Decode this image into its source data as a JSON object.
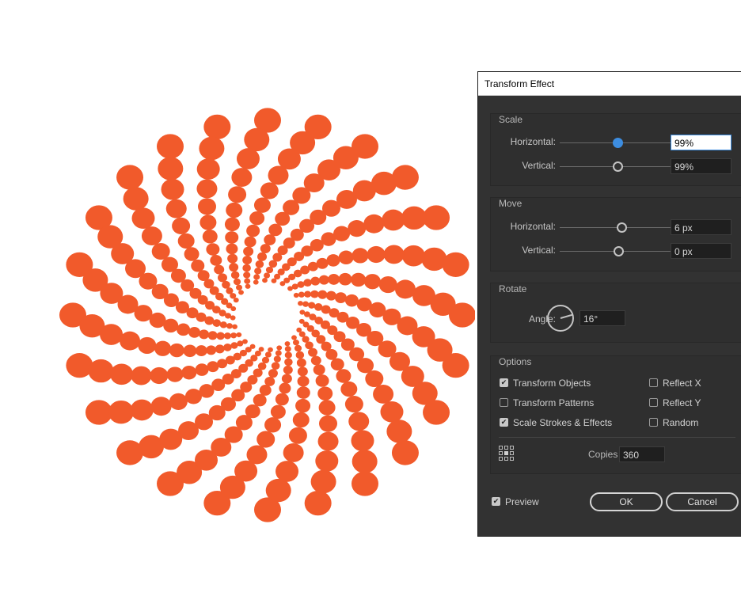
{
  "artwork": {
    "shape_color": "#f15a2b",
    "background": "#ffffff"
  },
  "dialog": {
    "title": "Transform Effect",
    "scale": {
      "title": "Scale",
      "horizontal_label": "Horizontal:",
      "horizontal_value": "99%",
      "vertical_label": "Vertical:",
      "vertical_value": "99%"
    },
    "move": {
      "title": "Move",
      "horizontal_label": "Horizontal:",
      "horizontal_value": "6 px",
      "vertical_label": "Vertical:",
      "vertical_value": "0 px"
    },
    "rotate": {
      "title": "Rotate",
      "angle_label": "Angle:",
      "angle_value": "16°"
    },
    "options": {
      "title": "Options",
      "transform_objects": {
        "label": "Transform Objects",
        "checked": true
      },
      "transform_patterns": {
        "label": "Transform Patterns",
        "checked": false
      },
      "scale_strokes": {
        "label": "Scale Strokes & Effects",
        "checked": true
      },
      "reflect_x": {
        "label": "Reflect X",
        "checked": false
      },
      "reflect_y": {
        "label": "Reflect Y",
        "checked": false
      },
      "random": {
        "label": "Random",
        "checked": false
      },
      "copies_label": "Copies",
      "copies_value": "360"
    },
    "preview": {
      "label": "Preview",
      "checked": true
    },
    "ok_label": "OK",
    "cancel_label": "Cancel"
  }
}
